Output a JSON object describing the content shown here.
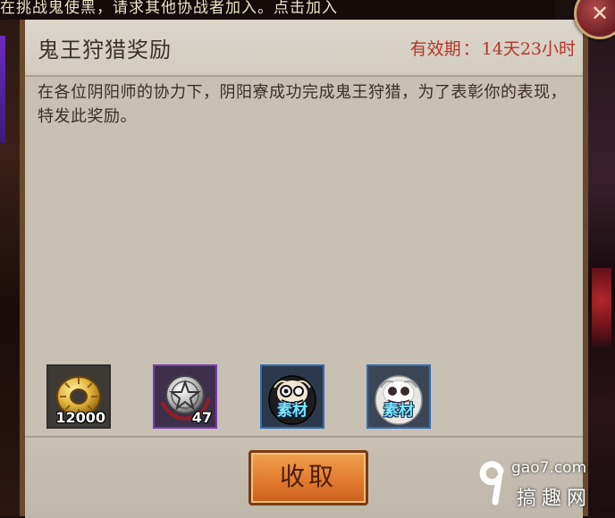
{
  "marquee": {
    "text": "在挑战鬼使黑，请求其他协战者加入。点击加入"
  },
  "mail": {
    "title": "鬼王狩猎奖励",
    "validity_label": "有效期",
    "validity_value": "14天23小时",
    "body": "在各位阴阳师的协力下，阴阳寮成功完成鬼王狩猎，为了表彰你的表现，特发此奖励。"
  },
  "rewards": [
    {
      "icon": "gold-coin-icon",
      "quantity": "12000"
    },
    {
      "icon": "pentagram-coin-icon",
      "quantity": "47"
    },
    {
      "icon": "black-daruma-icon",
      "tag": "素材"
    },
    {
      "icon": "white-daruma-icon",
      "tag": "素材"
    }
  ],
  "actions": {
    "collect_label": "收取"
  },
  "watermark": {
    "url": "gao7.com",
    "name": "搞趣网"
  },
  "colors": {
    "validity": "#b5352a",
    "panel": "#c7c0b3",
    "button": "#e0782c",
    "material_tag": "#7fe6ff"
  }
}
